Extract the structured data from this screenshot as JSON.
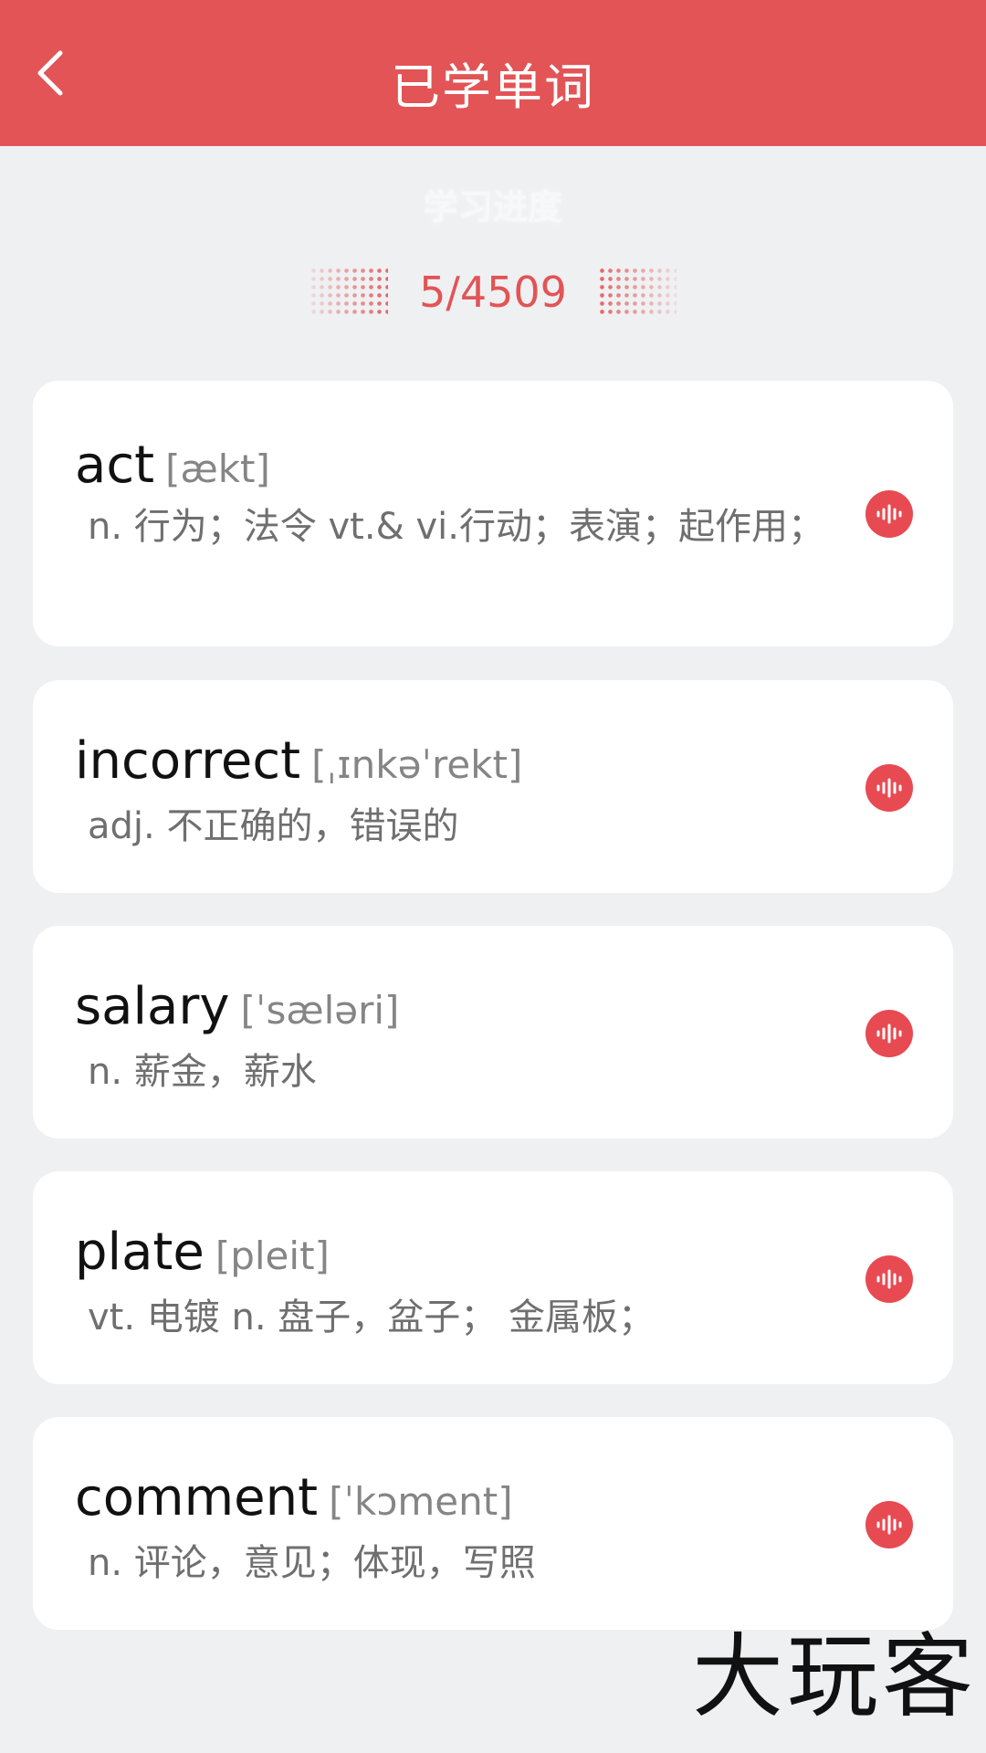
{
  "header": {
    "title": "已学单词",
    "back_icon": "chevron-left-icon"
  },
  "progress": {
    "label": "学习进度",
    "value": "5/4509",
    "learned": 5,
    "total": 4509
  },
  "words": [
    {
      "word": "act",
      "phonetic": "[ækt]",
      "meaning": "n. 行为；法令  vt.& vi.行动；表演；起作用；"
    },
    {
      "word": "incorrect",
      "phonetic": "[ˌɪnkəˈrekt]",
      "meaning": "adj. 不正确的，错误的"
    },
    {
      "word": "salary",
      "phonetic": "[ˈsæləri]",
      "meaning": "n. 薪金，薪水"
    },
    {
      "word": "plate",
      "phonetic": "[pleit]",
      "meaning": "vt. 电镀  n. 盘子，盆子；  金属板；"
    },
    {
      "word": "comment",
      "phonetic": "[ˈkɔment]",
      "meaning": "n. 评论，意见；体现，写照"
    }
  ],
  "audio_icon": "audio-wave-icon",
  "watermark": "大玩客",
  "colors": {
    "accent": "#e25456",
    "audio": "#e84a52",
    "background": "#eff0f2"
  }
}
